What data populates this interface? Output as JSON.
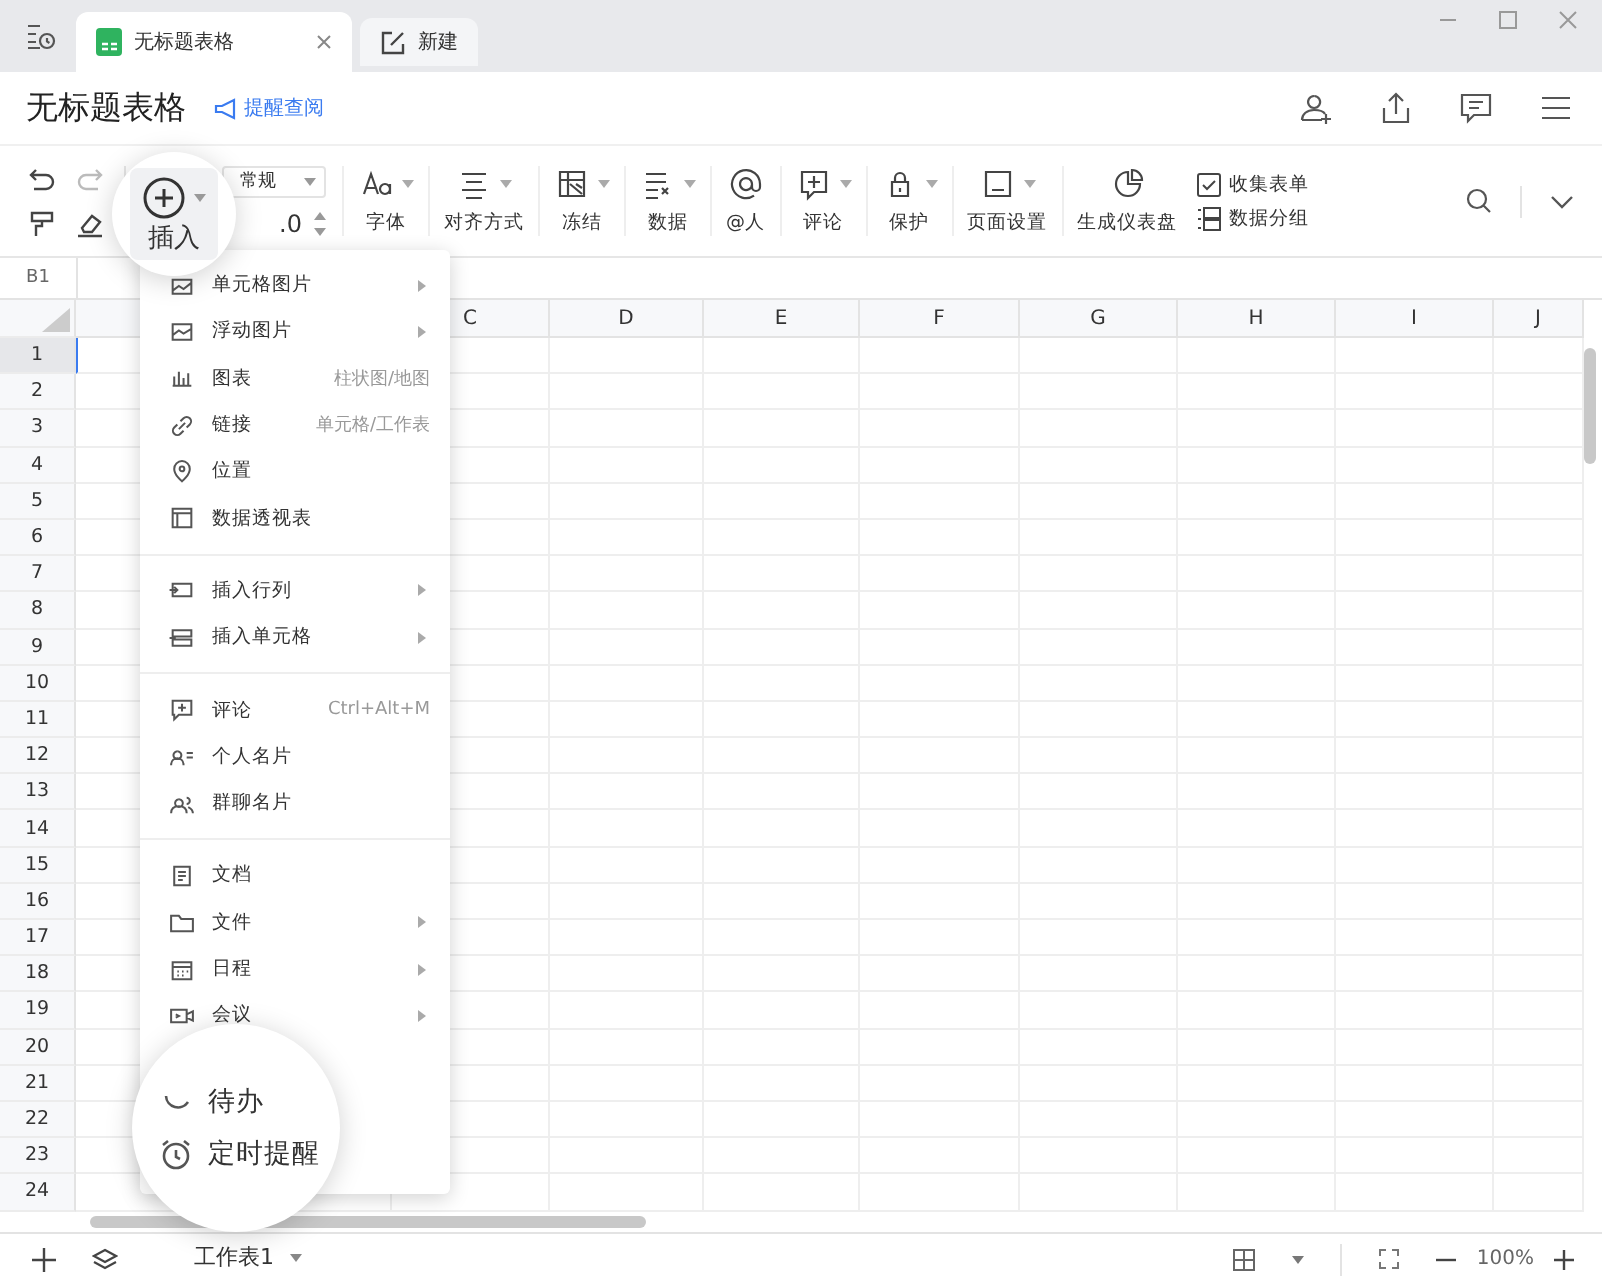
{
  "tabs": [
    {
      "label": "无标题表格",
      "selected": true,
      "closable": true
    },
    {
      "label": "新建",
      "selected": false,
      "closable": false
    }
  ],
  "doc": {
    "title": "无标题表格",
    "remind_link": "提醒查阅"
  },
  "toolbar": {
    "insert_label": "插入",
    "number_format": "常规",
    "decimal": ".0",
    "groups": [
      {
        "label": "字体",
        "caret": true
      },
      {
        "label": "对齐方式",
        "caret": true
      },
      {
        "label": "冻结",
        "caret": true
      },
      {
        "label": "数据",
        "caret": true
      },
      {
        "label": "@人",
        "caret": false
      },
      {
        "label": "评论",
        "caret": true
      },
      {
        "label": "保护",
        "caret": true
      },
      {
        "label": "页面设置",
        "caret": true
      },
      {
        "label": "生成仪表盘",
        "caret": false
      }
    ],
    "stacked": [
      {
        "label": "收集表单"
      },
      {
        "label": "数据分组"
      }
    ]
  },
  "name_box": "B1",
  "columns": [
    "C",
    "D",
    "E",
    "F",
    "G",
    "H",
    "I",
    "J"
  ],
  "rows": [
    {
      "label": "1",
      "selected": true
    },
    {
      "label": "2",
      "selected": false
    },
    {
      "label": "3",
      "selected": false
    },
    {
      "label": "4",
      "selected": false
    },
    {
      "label": "5",
      "selected": false
    },
    {
      "label": "6",
      "selected": false
    },
    {
      "label": "7",
      "selected": false
    },
    {
      "label": "8",
      "selected": false
    },
    {
      "label": "9",
      "selected": false
    },
    {
      "label": "10",
      "selected": false
    },
    {
      "label": "11",
      "selected": false
    },
    {
      "label": "12",
      "selected": false
    },
    {
      "label": "13",
      "selected": false
    },
    {
      "label": "14",
      "selected": false
    },
    {
      "label": "15",
      "selected": false
    },
    {
      "label": "16",
      "selected": false
    },
    {
      "label": "17",
      "selected": false
    },
    {
      "label": "18",
      "selected": false
    },
    {
      "label": "19",
      "selected": false
    },
    {
      "label": "20",
      "selected": false
    },
    {
      "label": "21",
      "selected": false
    },
    {
      "label": "22",
      "selected": false
    },
    {
      "label": "23",
      "selected": false
    },
    {
      "label": "24",
      "selected": false
    }
  ],
  "menu": {
    "sections": [
      [
        {
          "label": "单元格图片",
          "submenu": true
        },
        {
          "label": "浮动图片",
          "submenu": true
        },
        {
          "label": "图表",
          "hint": "柱状图/地图",
          "submenu": false
        },
        {
          "label": "链接",
          "hint": "单元格/工作表",
          "submenu": false
        },
        {
          "label": "位置",
          "submenu": false
        },
        {
          "label": "数据透视表",
          "submenu": false
        }
      ],
      [
        {
          "label": "插入行列",
          "submenu": true
        },
        {
          "label": "插入单元格",
          "submenu": true
        }
      ],
      [
        {
          "label": "评论",
          "hint": "Ctrl+Alt+M",
          "submenu": false
        },
        {
          "label": "个人名片",
          "submenu": false
        },
        {
          "label": "群聊名片",
          "submenu": false
        }
      ],
      [
        {
          "label": "文档",
          "submenu": false
        },
        {
          "label": "文件",
          "submenu": true
        },
        {
          "label": "日程",
          "submenu": true
        },
        {
          "label": "会议",
          "submenu": true
        }
      ]
    ]
  },
  "magnified_items": [
    {
      "label": "待办"
    },
    {
      "label": "定时提醒"
    }
  ],
  "sheet_tabs": [
    {
      "label": "工作表1",
      "selected": true
    }
  ],
  "zoom": "100%"
}
